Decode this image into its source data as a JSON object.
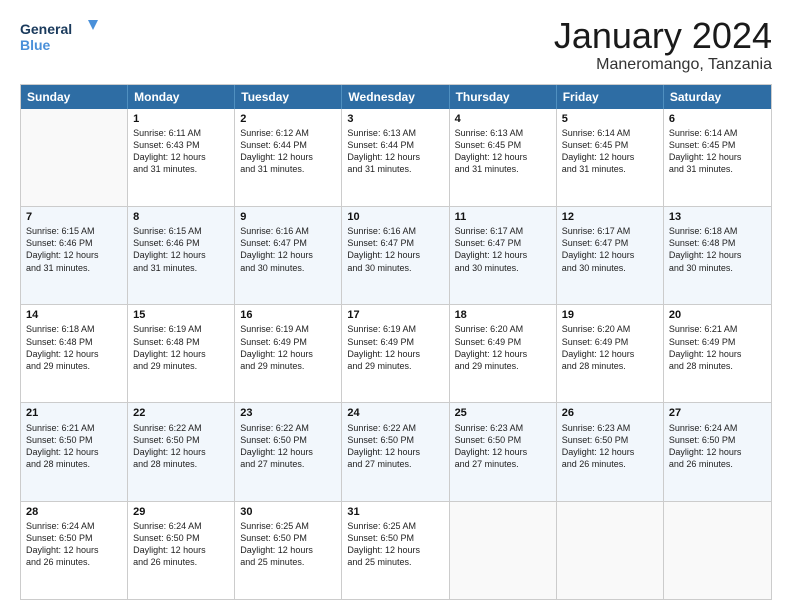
{
  "logo": {
    "line1": "General",
    "line2": "Blue"
  },
  "title": "January 2024",
  "subtitle": "Maneromango, Tanzania",
  "days": [
    "Sunday",
    "Monday",
    "Tuesday",
    "Wednesday",
    "Thursday",
    "Friday",
    "Saturday"
  ],
  "weeks": [
    [
      {
        "day": "",
        "text": ""
      },
      {
        "day": "1",
        "text": "Sunrise: 6:11 AM\nSunset: 6:43 PM\nDaylight: 12 hours\nand 31 minutes."
      },
      {
        "day": "2",
        "text": "Sunrise: 6:12 AM\nSunset: 6:44 PM\nDaylight: 12 hours\nand 31 minutes."
      },
      {
        "day": "3",
        "text": "Sunrise: 6:13 AM\nSunset: 6:44 PM\nDaylight: 12 hours\nand 31 minutes."
      },
      {
        "day": "4",
        "text": "Sunrise: 6:13 AM\nSunset: 6:45 PM\nDaylight: 12 hours\nand 31 minutes."
      },
      {
        "day": "5",
        "text": "Sunrise: 6:14 AM\nSunset: 6:45 PM\nDaylight: 12 hours\nand 31 minutes."
      },
      {
        "day": "6",
        "text": "Sunrise: 6:14 AM\nSunset: 6:45 PM\nDaylight: 12 hours\nand 31 minutes."
      }
    ],
    [
      {
        "day": "7",
        "text": "Sunrise: 6:15 AM\nSunset: 6:46 PM\nDaylight: 12 hours\nand 31 minutes."
      },
      {
        "day": "8",
        "text": "Sunrise: 6:15 AM\nSunset: 6:46 PM\nDaylight: 12 hours\nand 31 minutes."
      },
      {
        "day": "9",
        "text": "Sunrise: 6:16 AM\nSunset: 6:47 PM\nDaylight: 12 hours\nand 30 minutes."
      },
      {
        "day": "10",
        "text": "Sunrise: 6:16 AM\nSunset: 6:47 PM\nDaylight: 12 hours\nand 30 minutes."
      },
      {
        "day": "11",
        "text": "Sunrise: 6:17 AM\nSunset: 6:47 PM\nDaylight: 12 hours\nand 30 minutes."
      },
      {
        "day": "12",
        "text": "Sunrise: 6:17 AM\nSunset: 6:47 PM\nDaylight: 12 hours\nand 30 minutes."
      },
      {
        "day": "13",
        "text": "Sunrise: 6:18 AM\nSunset: 6:48 PM\nDaylight: 12 hours\nand 30 minutes."
      }
    ],
    [
      {
        "day": "14",
        "text": "Sunrise: 6:18 AM\nSunset: 6:48 PM\nDaylight: 12 hours\nand 29 minutes."
      },
      {
        "day": "15",
        "text": "Sunrise: 6:19 AM\nSunset: 6:48 PM\nDaylight: 12 hours\nand 29 minutes."
      },
      {
        "day": "16",
        "text": "Sunrise: 6:19 AM\nSunset: 6:49 PM\nDaylight: 12 hours\nand 29 minutes."
      },
      {
        "day": "17",
        "text": "Sunrise: 6:19 AM\nSunset: 6:49 PM\nDaylight: 12 hours\nand 29 minutes."
      },
      {
        "day": "18",
        "text": "Sunrise: 6:20 AM\nSunset: 6:49 PM\nDaylight: 12 hours\nand 29 minutes."
      },
      {
        "day": "19",
        "text": "Sunrise: 6:20 AM\nSunset: 6:49 PM\nDaylight: 12 hours\nand 28 minutes."
      },
      {
        "day": "20",
        "text": "Sunrise: 6:21 AM\nSunset: 6:49 PM\nDaylight: 12 hours\nand 28 minutes."
      }
    ],
    [
      {
        "day": "21",
        "text": "Sunrise: 6:21 AM\nSunset: 6:50 PM\nDaylight: 12 hours\nand 28 minutes."
      },
      {
        "day": "22",
        "text": "Sunrise: 6:22 AM\nSunset: 6:50 PM\nDaylight: 12 hours\nand 28 minutes."
      },
      {
        "day": "23",
        "text": "Sunrise: 6:22 AM\nSunset: 6:50 PM\nDaylight: 12 hours\nand 27 minutes."
      },
      {
        "day": "24",
        "text": "Sunrise: 6:22 AM\nSunset: 6:50 PM\nDaylight: 12 hours\nand 27 minutes."
      },
      {
        "day": "25",
        "text": "Sunrise: 6:23 AM\nSunset: 6:50 PM\nDaylight: 12 hours\nand 27 minutes."
      },
      {
        "day": "26",
        "text": "Sunrise: 6:23 AM\nSunset: 6:50 PM\nDaylight: 12 hours\nand 26 minutes."
      },
      {
        "day": "27",
        "text": "Sunrise: 6:24 AM\nSunset: 6:50 PM\nDaylight: 12 hours\nand 26 minutes."
      }
    ],
    [
      {
        "day": "28",
        "text": "Sunrise: 6:24 AM\nSunset: 6:50 PM\nDaylight: 12 hours\nand 26 minutes."
      },
      {
        "day": "29",
        "text": "Sunrise: 6:24 AM\nSunset: 6:50 PM\nDaylight: 12 hours\nand 26 minutes."
      },
      {
        "day": "30",
        "text": "Sunrise: 6:25 AM\nSunset: 6:50 PM\nDaylight: 12 hours\nand 25 minutes."
      },
      {
        "day": "31",
        "text": "Sunrise: 6:25 AM\nSunset: 6:50 PM\nDaylight: 12 hours\nand 25 minutes."
      },
      {
        "day": "",
        "text": ""
      },
      {
        "day": "",
        "text": ""
      },
      {
        "day": "",
        "text": ""
      }
    ]
  ]
}
